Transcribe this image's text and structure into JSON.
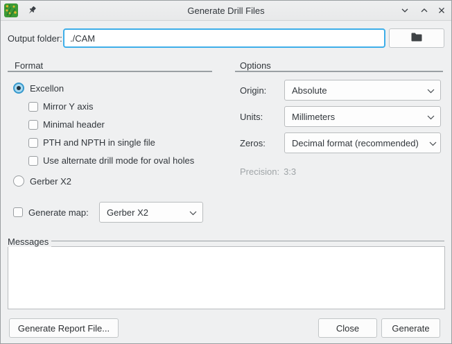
{
  "window": {
    "title": "Generate Drill Files"
  },
  "output_folder": {
    "label": "Output folder:",
    "value": "./CAM"
  },
  "format": {
    "title": "Format",
    "excellon_label": "Excellon",
    "checkboxes": [
      "Mirror Y axis",
      "Minimal header",
      "PTH and NPTH in single file",
      "Use alternate drill mode for oval holes"
    ],
    "gerber_label": "Gerber X2"
  },
  "map": {
    "label": "Generate map:",
    "value": "Gerber X2"
  },
  "options": {
    "title": "Options",
    "origin": {
      "label": "Origin:",
      "value": "Absolute"
    },
    "units": {
      "label": "Units:",
      "value": "Millimeters"
    },
    "zeros": {
      "label": "Zeros:",
      "value": "Decimal format (recommended)"
    },
    "precision_label": "Precision:",
    "precision_value": "3:3"
  },
  "messages": {
    "title": "Messages",
    "content": ""
  },
  "buttons": {
    "report": "Generate Report File...",
    "close": "Close",
    "generate": "Generate"
  },
  "colors": {
    "accent": "#3daee9",
    "window_bg": "#eff0f1",
    "icon_green": "#3c9a36",
    "icon_pad_yellow": "#e3b82a"
  }
}
